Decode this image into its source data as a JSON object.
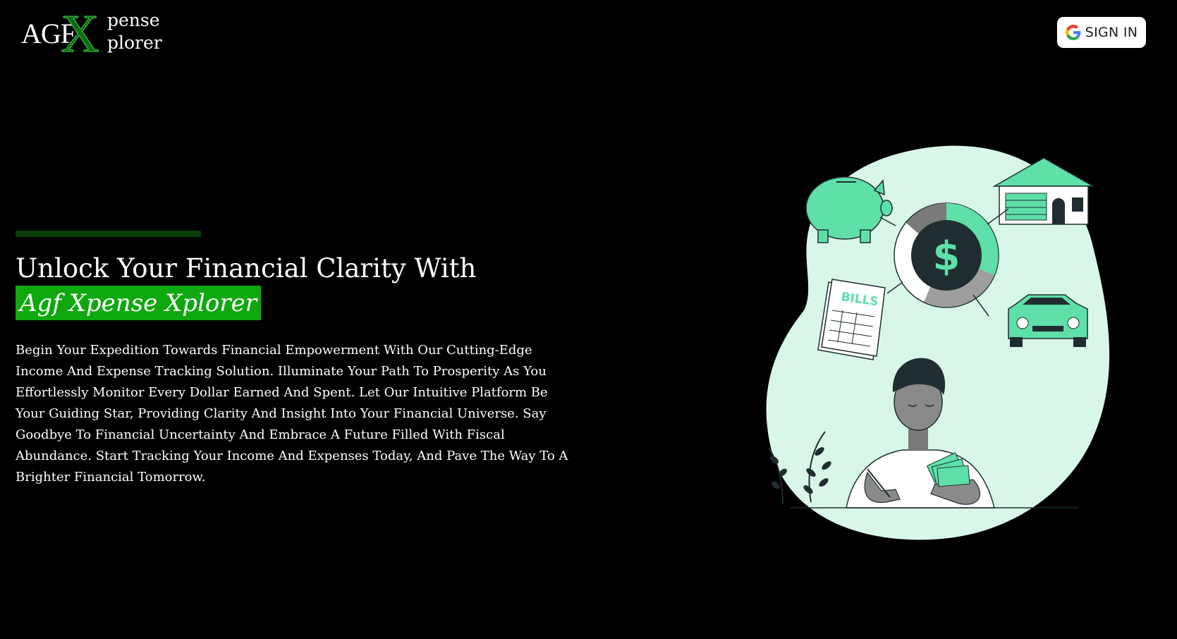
{
  "logo": {
    "prefix": "AGF",
    "x_letter": "X",
    "word_top": "pense",
    "word_bottom": "plorer"
  },
  "header": {
    "sign_in_label": "SIGN IN",
    "sign_in_icon": "google-icon"
  },
  "hero": {
    "headline": "Unlock Your Financial Clarity With",
    "brand_name": "Agf Xpense Xplorer",
    "description": "Begin Your Expedition Towards Financial Empowerment With Our Cutting-Edge Income And Expense Tracking Solution. Illuminate Your Path To Prosperity As You Effortlessly Monitor Every Dollar Earned And Spent. Let Our Intuitive Platform Be Your Guiding Star, Providing Clarity And Insight Into Your Financial Universe. Say Goodbye To Financial Uncertainty And Embrace A Future Filled With Fiscal Abundance. Start Tracking Your Income And Expenses Today, And Pave The Way To A Brighter Financial Tomorrow."
  },
  "illustration": {
    "bills_label": "BILLS",
    "currency_symbol": "$"
  },
  "colors": {
    "background": "#000000",
    "brand_green": "#0fa80f",
    "accent_bar": "#0b3d0b",
    "illustration_mint": "#d8f7e8",
    "illustration_green": "#5ee0a8",
    "dark_navy": "#1f2d30"
  }
}
